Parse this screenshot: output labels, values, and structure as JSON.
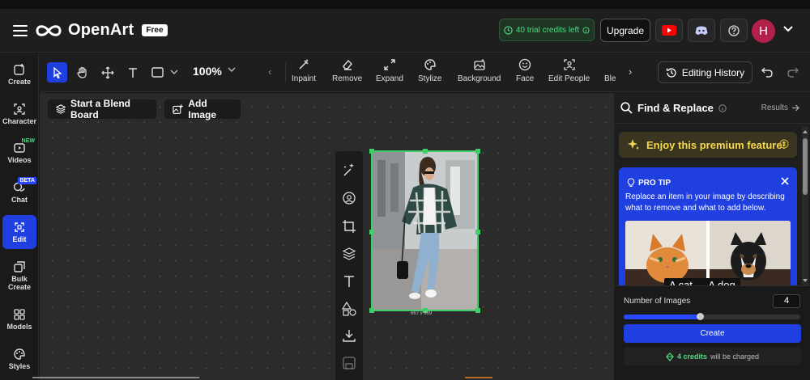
{
  "header": {
    "brand": "OpenArt",
    "plan_badge": "Free",
    "credits": "40 trial credits left",
    "upgrade": "Upgrade",
    "avatar_initial": "H"
  },
  "sidebar": {
    "items": [
      {
        "label": "Create",
        "icon": "create-icon"
      },
      {
        "label": "Character",
        "icon": "character-icon"
      },
      {
        "label": "Videos",
        "icon": "video-icon",
        "badge": "NEW"
      },
      {
        "label": "Chat",
        "icon": "chat-icon",
        "badge": "BETA"
      },
      {
        "label": "Edit",
        "icon": "edit-icon",
        "active": true
      },
      {
        "label": "Bulk Create",
        "icon": "bulk-create-icon"
      },
      {
        "label": "Models",
        "icon": "models-icon"
      },
      {
        "label": "Styles",
        "icon": "styles-icon"
      }
    ]
  },
  "toolbar": {
    "zoom": "100%",
    "features": [
      {
        "label": "Inpaint",
        "icon": "inpaint-icon"
      },
      {
        "label": "Remove",
        "icon": "remove-icon"
      },
      {
        "label": "Expand",
        "icon": "expand-icon"
      },
      {
        "label": "Stylize",
        "icon": "stylize-icon"
      },
      {
        "label": "Background",
        "icon": "background-icon"
      },
      {
        "label": "Face",
        "icon": "face-icon"
      },
      {
        "label": "Edit People",
        "icon": "edit-people-icon"
      },
      {
        "label": "Blen",
        "icon": "blend-icon"
      }
    ],
    "history": "Editing History"
  },
  "canvas": {
    "blend_board": "Start a Blend Board",
    "add_image": "Add Image",
    "image_dims": "667 x 999"
  },
  "panel": {
    "title": "Find & Replace",
    "results": "Results",
    "premium": "Enjoy this premium feature!",
    "protip_title": "PRO TIP",
    "protip_text": "Replace an item in your image by describing what to remove and what to add below.",
    "protip_caption": "A cat → A dog",
    "num_images_label": "Number of Images",
    "num_images": "4",
    "slider_fraction": 0.43,
    "create": "Create",
    "credits_amount": "4 credits",
    "credits_suffix": "will be charged"
  },
  "colors": {
    "accent": "#1f3fe0",
    "success": "#4ade80",
    "selection": "#3ccf6a",
    "avatar": "#b3214b"
  }
}
